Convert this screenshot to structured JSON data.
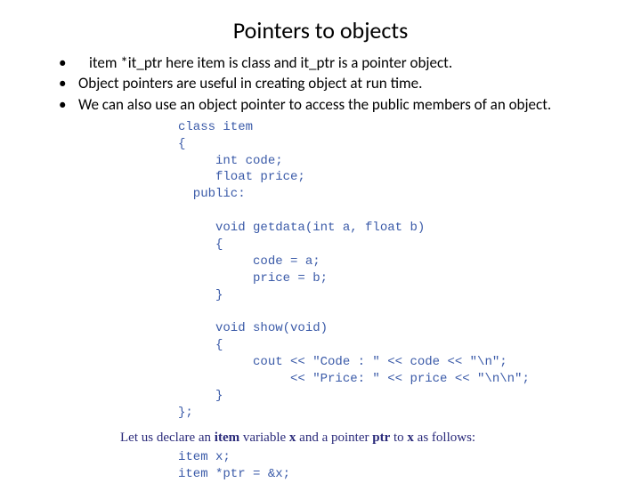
{
  "title": "Pointers to objects",
  "bullets": [
    "item *it_ptr here item is class and it_ptr is a pointer object.",
    "Object pointers are useful in creating object at run time.",
    "We can also use an object pointer to access the public members of an object."
  ],
  "code": {
    "l1": "class item",
    "l2": "{",
    "l3": "     int code;",
    "l4": "     float price;",
    "l5": "  public:",
    "l6": "",
    "l7": "     void getdata(int a, float b)",
    "l8": "     {",
    "l9": "          code = a;",
    "l10": "          price = b;",
    "l11": "     }",
    "l12": "",
    "l13": "     void show(void)",
    "l14": "     {",
    "l15": "          cout << \"Code : \" << code << \"\\n\";",
    "l16": "               << \"Price: \" << price << \"\\n\\n\";",
    "l17": "     }",
    "l18": "};"
  },
  "caption": {
    "pre": "Let us declare an ",
    "b1": "item",
    "mid1": " variable ",
    "b2": "x",
    "mid2": " and a pointer ",
    "b3": "ptr",
    "mid3": " to ",
    "b4": "x",
    "post": " as follows:"
  },
  "code2": {
    "l1": "item x;",
    "l2": "item *ptr = &x;"
  }
}
